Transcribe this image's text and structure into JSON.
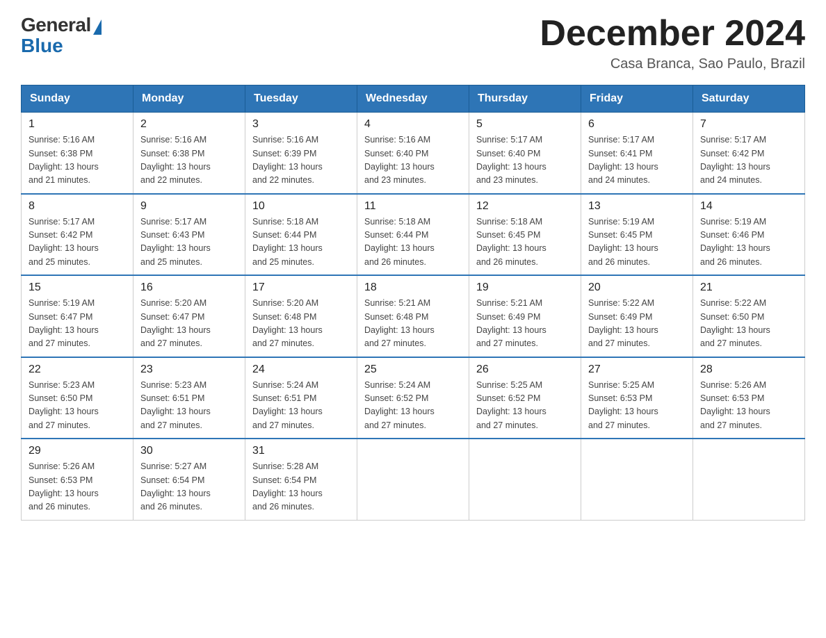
{
  "logo": {
    "general": "General",
    "blue": "Blue"
  },
  "title": "December 2024",
  "subtitle": "Casa Branca, Sao Paulo, Brazil",
  "days_of_week": [
    "Sunday",
    "Monday",
    "Tuesday",
    "Wednesday",
    "Thursday",
    "Friday",
    "Saturday"
  ],
  "weeks": [
    [
      {
        "day": "1",
        "sunrise": "5:16 AM",
        "sunset": "6:38 PM",
        "daylight": "13 hours and 21 minutes."
      },
      {
        "day": "2",
        "sunrise": "5:16 AM",
        "sunset": "6:38 PM",
        "daylight": "13 hours and 22 minutes."
      },
      {
        "day": "3",
        "sunrise": "5:16 AM",
        "sunset": "6:39 PM",
        "daylight": "13 hours and 22 minutes."
      },
      {
        "day": "4",
        "sunrise": "5:16 AM",
        "sunset": "6:40 PM",
        "daylight": "13 hours and 23 minutes."
      },
      {
        "day": "5",
        "sunrise": "5:17 AM",
        "sunset": "6:40 PM",
        "daylight": "13 hours and 23 minutes."
      },
      {
        "day": "6",
        "sunrise": "5:17 AM",
        "sunset": "6:41 PM",
        "daylight": "13 hours and 24 minutes."
      },
      {
        "day": "7",
        "sunrise": "5:17 AM",
        "sunset": "6:42 PM",
        "daylight": "13 hours and 24 minutes."
      }
    ],
    [
      {
        "day": "8",
        "sunrise": "5:17 AM",
        "sunset": "6:42 PM",
        "daylight": "13 hours and 25 minutes."
      },
      {
        "day": "9",
        "sunrise": "5:17 AM",
        "sunset": "6:43 PM",
        "daylight": "13 hours and 25 minutes."
      },
      {
        "day": "10",
        "sunrise": "5:18 AM",
        "sunset": "6:44 PM",
        "daylight": "13 hours and 25 minutes."
      },
      {
        "day": "11",
        "sunrise": "5:18 AM",
        "sunset": "6:44 PM",
        "daylight": "13 hours and 26 minutes."
      },
      {
        "day": "12",
        "sunrise": "5:18 AM",
        "sunset": "6:45 PM",
        "daylight": "13 hours and 26 minutes."
      },
      {
        "day": "13",
        "sunrise": "5:19 AM",
        "sunset": "6:45 PM",
        "daylight": "13 hours and 26 minutes."
      },
      {
        "day": "14",
        "sunrise": "5:19 AM",
        "sunset": "6:46 PM",
        "daylight": "13 hours and 26 minutes."
      }
    ],
    [
      {
        "day": "15",
        "sunrise": "5:19 AM",
        "sunset": "6:47 PM",
        "daylight": "13 hours and 27 minutes."
      },
      {
        "day": "16",
        "sunrise": "5:20 AM",
        "sunset": "6:47 PM",
        "daylight": "13 hours and 27 minutes."
      },
      {
        "day": "17",
        "sunrise": "5:20 AM",
        "sunset": "6:48 PM",
        "daylight": "13 hours and 27 minutes."
      },
      {
        "day": "18",
        "sunrise": "5:21 AM",
        "sunset": "6:48 PM",
        "daylight": "13 hours and 27 minutes."
      },
      {
        "day": "19",
        "sunrise": "5:21 AM",
        "sunset": "6:49 PM",
        "daylight": "13 hours and 27 minutes."
      },
      {
        "day": "20",
        "sunrise": "5:22 AM",
        "sunset": "6:49 PM",
        "daylight": "13 hours and 27 minutes."
      },
      {
        "day": "21",
        "sunrise": "5:22 AM",
        "sunset": "6:50 PM",
        "daylight": "13 hours and 27 minutes."
      }
    ],
    [
      {
        "day": "22",
        "sunrise": "5:23 AM",
        "sunset": "6:50 PM",
        "daylight": "13 hours and 27 minutes."
      },
      {
        "day": "23",
        "sunrise": "5:23 AM",
        "sunset": "6:51 PM",
        "daylight": "13 hours and 27 minutes."
      },
      {
        "day": "24",
        "sunrise": "5:24 AM",
        "sunset": "6:51 PM",
        "daylight": "13 hours and 27 minutes."
      },
      {
        "day": "25",
        "sunrise": "5:24 AM",
        "sunset": "6:52 PM",
        "daylight": "13 hours and 27 minutes."
      },
      {
        "day": "26",
        "sunrise": "5:25 AM",
        "sunset": "6:52 PM",
        "daylight": "13 hours and 27 minutes."
      },
      {
        "day": "27",
        "sunrise": "5:25 AM",
        "sunset": "6:53 PM",
        "daylight": "13 hours and 27 minutes."
      },
      {
        "day": "28",
        "sunrise": "5:26 AM",
        "sunset": "6:53 PM",
        "daylight": "13 hours and 27 minutes."
      }
    ],
    [
      {
        "day": "29",
        "sunrise": "5:26 AM",
        "sunset": "6:53 PM",
        "daylight": "13 hours and 26 minutes."
      },
      {
        "day": "30",
        "sunrise": "5:27 AM",
        "sunset": "6:54 PM",
        "daylight": "13 hours and 26 minutes."
      },
      {
        "day": "31",
        "sunrise": "5:28 AM",
        "sunset": "6:54 PM",
        "daylight": "13 hours and 26 minutes."
      },
      null,
      null,
      null,
      null
    ]
  ],
  "labels": {
    "sunrise": "Sunrise:",
    "sunset": "Sunset:",
    "daylight": "Daylight:"
  }
}
